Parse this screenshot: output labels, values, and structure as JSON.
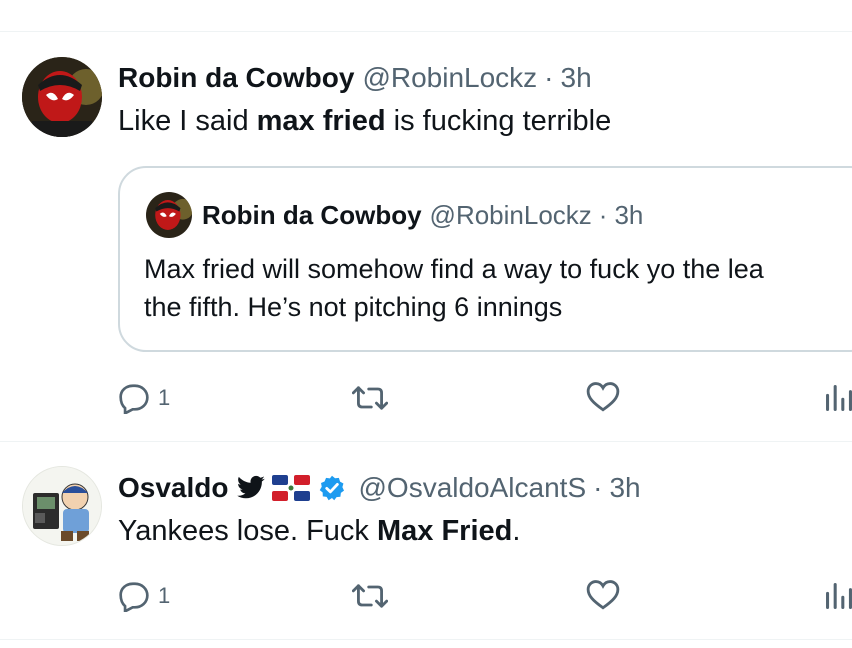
{
  "tweets": [
    {
      "display_name": "Robin da Cowboy",
      "handle": "@RobinLockz",
      "separator": "·",
      "time": "3h",
      "text_parts": [
        "Like I said ",
        "max fried",
        " is fucking terrible"
      ],
      "quote": {
        "display_name": "Robin da Cowboy",
        "handle": "@RobinLockz",
        "separator": "·",
        "time": "3h",
        "line1": "Max fried will somehow find a way to fuck yo the lea",
        "line2": "the fifth. He’s not pitching 6 innings"
      },
      "actions": {
        "reply_count": "1"
      }
    },
    {
      "display_name": "Osvaldo",
      "handle": "@OsvaldoAlcantS",
      "separator": "·",
      "time": "3h",
      "text_parts": [
        "Yankees lose. Fuck ",
        "Max Fried",
        "."
      ],
      "actions": {
        "reply_count": "1"
      }
    }
  ],
  "icons": [
    "reply-icon",
    "retweet-icon",
    "like-icon",
    "views-icon",
    "twitter-bird-icon",
    "dominican-flag-icon",
    "verified-badge-icon"
  ],
  "colors": {
    "text": "#0f1419",
    "secondary": "#536471",
    "verified": "#1d9bf0",
    "border": "#cfd9de"
  }
}
